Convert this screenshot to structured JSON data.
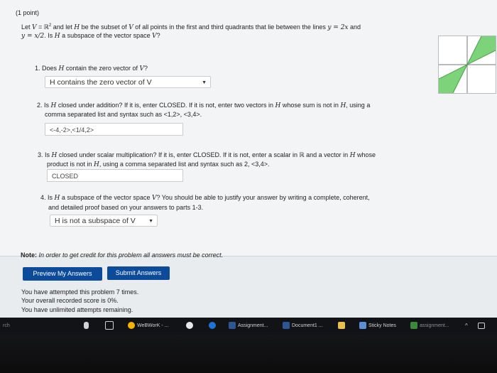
{
  "problem": {
    "points": "(1 point)",
    "intro": {
      "l1a": "Let ",
      "V": "V",
      "eq": " = ℝ",
      "sup": "2",
      "l1b": " and let ",
      "H": "H",
      "l1c": " be the subset of ",
      "V2": "V",
      "l1d": " of all points in the first and third quadrants that lie between the lines ",
      "eq1": "y = 2x",
      "l1e": " and",
      "eq2": "y = x/2",
      "l2a": ". Is ",
      "H2": "H",
      "l2b": " a subspace of the vector space ",
      "V3": "V",
      "l2c": "?"
    },
    "q1": {
      "text_a": "1. Does ",
      "H": "H",
      "text_b": " contain the zero vector of ",
      "V": "V",
      "text_c": "?",
      "answer": "H contains the zero vector of V"
    },
    "q2": {
      "line1_a": "2. Is ",
      "H": "H",
      "line1_b": " closed under addition? If it is, enter CLOSED. If it is not, enter two vectors in ",
      "H2": "H",
      "line1_c": " whose sum is not in ",
      "H3": "H",
      "line1_d": ", using a",
      "line2": "comma separated list and syntax such as <1,2>, <3,4>.",
      "answer": "<-4,-2>,<1/4,2>"
    },
    "q3": {
      "line1_a": "3. Is ",
      "H": "H",
      "line1_b": " closed under scalar multiplication? If it is, enter CLOSED. If it is not, enter a scalar in ℝ and a vector in ",
      "H2": "H",
      "line1_c": " whose",
      "line2_a": "product is not in ",
      "H3": "H",
      "line2_b": ", using a comma separated list and syntax such as 2, <3,4>.",
      "answer": "CLOSED"
    },
    "q4": {
      "line1_a": "4. Is ",
      "H": "H",
      "line1_b": " a subspace of the vector space ",
      "V": "V",
      "line1_c": "? You should be able to justify your answer by writing a complete, coherent,",
      "line2": "and detailed proof based on your answers to parts 1-3.",
      "answer": "H is not a subspace of V"
    }
  },
  "note": {
    "label": "Note:",
    "text": " In order to get credit for this problem all answers must be correct."
  },
  "buttons": {
    "preview": "Preview My Answers",
    "submit": "Submit Answers"
  },
  "status": {
    "line1": "You have attempted this problem 7 times.",
    "line2": "Your overall recorded score is 0%.",
    "line3": "You have unlimited attempts remaining."
  },
  "taskbar": {
    "search": "rch",
    "webwork": "WeBWorK - ...",
    "assignment": "Assignment...",
    "document": "Document1 ...",
    "sticky": "Sticky Notes",
    "assignment2": "assignment..."
  },
  "colors": {
    "button": "#0c4a9a",
    "region_fill": "#7dd37a"
  }
}
